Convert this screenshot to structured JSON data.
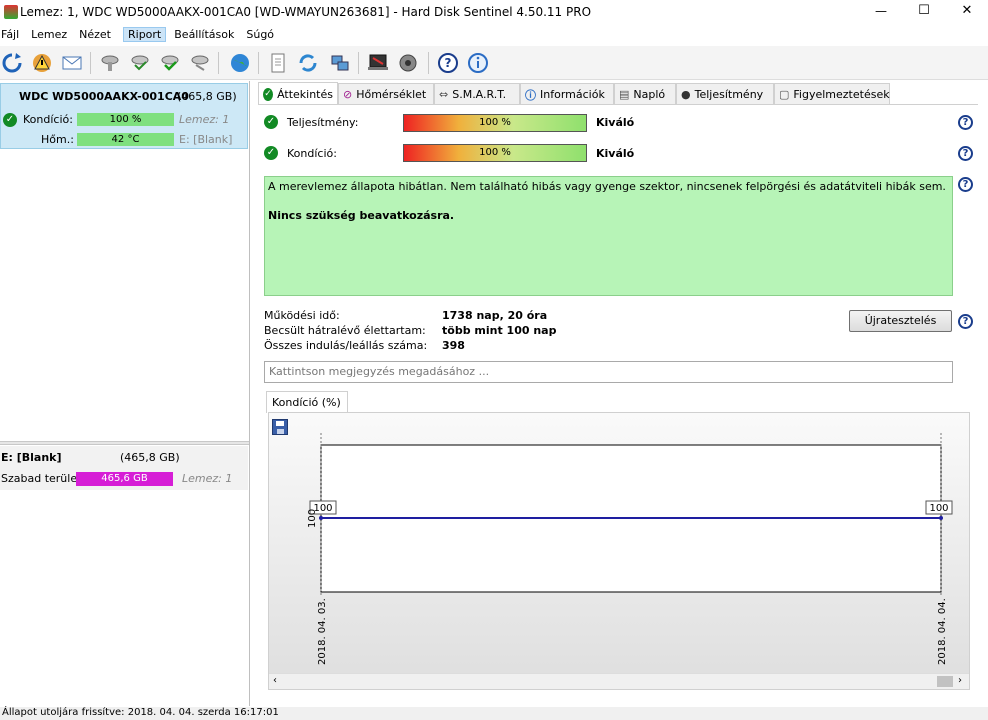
{
  "window": {
    "title": "Lemez: 1, WDC WD5000AAKX-001CA0 [WD-WMAYUN263681]  -  Hard Disk Sentinel 4.50.11 PRO",
    "controls": [
      "—",
      "☐",
      "✕"
    ]
  },
  "menu": [
    "Fájl",
    "Lemez",
    "Nézet",
    "Riport",
    "Beállítások",
    "Súgó"
  ],
  "menu_selected": "Riport",
  "toolbar_icons": [
    "refresh-icon",
    "warning-icon",
    "report-icon",
    "drive-disk-icon-1",
    "drive-disk-icon-2",
    "drive-disk-icon-3",
    "drive-disk-icon-4",
    "globe-icon",
    "document-icon",
    "copy-icon",
    "network-icon",
    "laptop-icon",
    "speaker-icon",
    "help-icon",
    "info-icon"
  ],
  "left": {
    "disk": {
      "name": "WDC WD5000AAKX-001CA0",
      "size": "(465,8 GB)",
      "condition_label": "Kondíció:",
      "condition_value": "100 %",
      "condition_extra": "Lemez: 1",
      "temp_label": "Hőm.:",
      "temp_value": "42 °C",
      "temp_extra": "E: [Blank]"
    },
    "volume": {
      "name": "E: [Blank]",
      "size": "(465,8 GB)",
      "free_label": "Szabad terület",
      "free_value": "465,6 GB",
      "disk_ref": "Lemez: 1"
    }
  },
  "tabs": [
    "Áttekintés",
    "Hőmérséklet",
    "S.M.A.R.T.",
    "Információk",
    "Napló",
    "Teljesítmény",
    "Figyelmeztetések"
  ],
  "active_tab": "Áttekintés",
  "overview": {
    "performance_label": "Teljesítmény:",
    "performance_value": "100 %",
    "performance_rating": "Kiváló",
    "condition_label": "Kondíció:",
    "condition_value": "100 %",
    "condition_rating": "Kiváló",
    "status_text": "A merevlemez állapota hibátlan. Nem található hibás vagy gyenge szektor, nincsenek felpörgési és adatátviteli hibák sem.",
    "status_action": "Nincs szükség beavatkozásra.",
    "uptime_label": "Működési idő:",
    "uptime_value": "1738 nap, 20 óra",
    "lifetime_label": "Becsült hátralévő élettartam:",
    "lifetime_value": "több mint 100 nap",
    "startstop_label": "Összes indulás/leállás száma:",
    "startstop_value": "398",
    "retest_button": "Újratesztelés",
    "note_placeholder": "Kattintson megjegyzés megadásához ..."
  },
  "chart_tab": "Kondíció  (%)",
  "chart_data": {
    "type": "line",
    "x": [
      "2018. 04. 03.",
      "2018. 04. 04."
    ],
    "series": [
      {
        "values": [
          100,
          100
        ]
      }
    ],
    "data_labels": [
      "100",
      "100"
    ],
    "ytick": "100",
    "color": "#1e1ea0"
  },
  "status_bar": "Állapot utoljára frissítve: 2018. 04. 04. szerda 16:17:01"
}
